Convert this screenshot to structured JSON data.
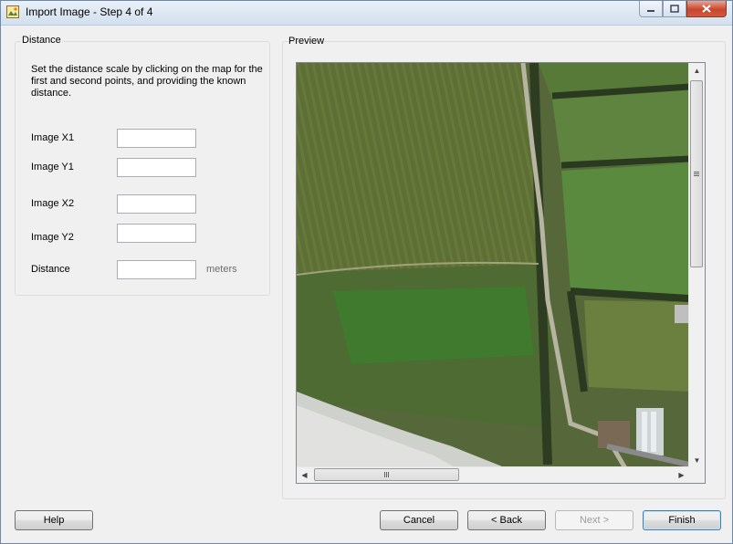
{
  "window": {
    "title": "Import Image - Step 4 of 4",
    "icons": {
      "app": "image-icon",
      "minimize": "minimize-icon",
      "maximize": "maximize-icon",
      "close": "close-icon"
    }
  },
  "distance_group": {
    "label": "Distance",
    "instructions": "Set the distance scale by clicking on the map for the first and second points, and providing the known distance.",
    "fields": [
      {
        "label": "Image X1",
        "value": ""
      },
      {
        "label": "Image Y1",
        "value": ""
      },
      {
        "label": "Image X2",
        "value": ""
      },
      {
        "label": "Image Y2",
        "value": ""
      },
      {
        "label": "Distance",
        "value": ""
      }
    ],
    "units": "meters"
  },
  "preview_group": {
    "label": "Preview",
    "image_description": "aerial-map"
  },
  "buttons": {
    "help": "Help",
    "cancel": "Cancel",
    "back": "< Back",
    "next": "Next >",
    "finish": "Finish"
  },
  "states": {
    "next_disabled": true
  },
  "colors": {
    "close_button": "#c9462c",
    "field_border": "#abadb3"
  }
}
